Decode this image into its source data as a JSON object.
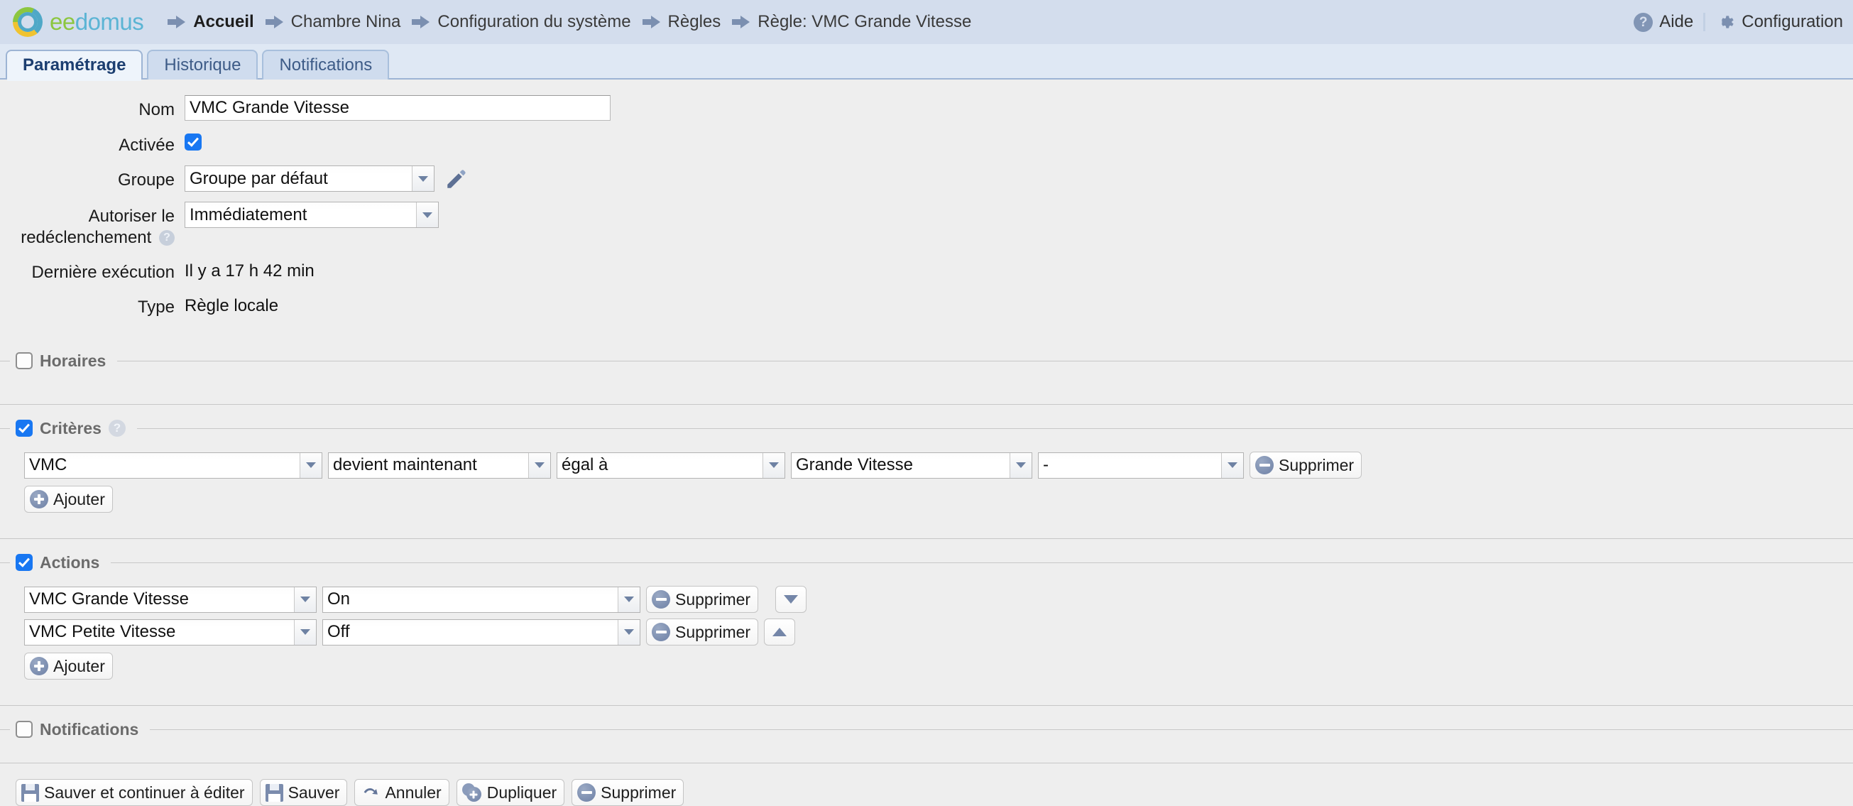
{
  "brand": {
    "name_part1": "ee",
    "name_part2": "domus",
    "logo_icon": "eedomus-ring-logo",
    "colors": {
      "green": "#8cc63f",
      "blue": "#5bb4d4",
      "yellow": "#f0c330"
    }
  },
  "header": {
    "breadcrumb": [
      {
        "label": "Accueil",
        "bold": true
      },
      {
        "label": "Chambre Nina",
        "bold": false
      },
      {
        "label": "Configuration du système",
        "bold": false
      },
      {
        "label": "Règles",
        "bold": false
      },
      {
        "label": "Règle: VMC Grande Vitesse",
        "bold": false
      }
    ],
    "help_label": "Aide",
    "help_icon": "question-mark-icon",
    "config_label": "Configuration",
    "config_icon": "gear-icon",
    "bg_color": "#d3dded"
  },
  "tabs": [
    {
      "label": "Paramétrage",
      "active": true
    },
    {
      "label": "Historique",
      "active": false
    },
    {
      "label": "Notifications",
      "active": false
    }
  ],
  "form": {
    "nom": {
      "label": "Nom",
      "value": "VMC Grande Vitesse",
      "placeholder": ""
    },
    "activee": {
      "label": "Activée",
      "checked": true
    },
    "groupe": {
      "label": "Groupe",
      "value": "Groupe par défaut",
      "edit_icon": "pencil-icon"
    },
    "redeclenchement": {
      "label_line1": "Autoriser le",
      "label_line2": "redéclenchement",
      "help_icon": "question-mark-icon",
      "value": "Immédiatement"
    },
    "derniere_execution": {
      "label": "Dernière exécution",
      "value": "Il y a 17 h 42 min"
    },
    "type": {
      "label": "Type",
      "value": "Règle locale"
    }
  },
  "sections": {
    "horaires": {
      "title": "Horaires",
      "checked": false
    },
    "criteres": {
      "title": "Critères",
      "checked": true,
      "help_icon": "question-mark-icon",
      "rows": [
        {
          "device": "VMC",
          "event": "devient maintenant",
          "operator": "égal à",
          "value": "Grande Vitesse",
          "extra": "-",
          "delete_label": "Supprimer",
          "delete_icon": "minus-circle-icon"
        }
      ],
      "add_label": "Ajouter",
      "add_icon": "plus-circle-icon"
    },
    "actions": {
      "title": "Actions",
      "checked": true,
      "rows": [
        {
          "device": "VMC Grande Vitesse",
          "state": "On",
          "delete_label": "Supprimer",
          "delete_icon": "minus-circle-icon",
          "move_icon": "arrow-down-icon"
        },
        {
          "device": "VMC Petite Vitesse",
          "state": "Off",
          "delete_label": "Supprimer",
          "delete_icon": "minus-circle-icon",
          "move_icon": "arrow-up-icon"
        }
      ],
      "add_label": "Ajouter",
      "add_icon": "plus-circle-icon"
    },
    "notifications": {
      "title": "Notifications",
      "checked": false
    }
  },
  "footer": {
    "save_continue": {
      "label": "Sauver et continuer à éditer",
      "icon": "floppy-disk-icon"
    },
    "save": {
      "label": "Sauver",
      "icon": "floppy-disk-icon"
    },
    "cancel": {
      "label": "Annuler",
      "icon": "undo-arrow-icon"
    },
    "duplicate": {
      "label": "Dupliquer",
      "icon": "duplicate-icon"
    },
    "delete": {
      "label": "Supprimer",
      "icon": "minus-circle-icon"
    }
  }
}
